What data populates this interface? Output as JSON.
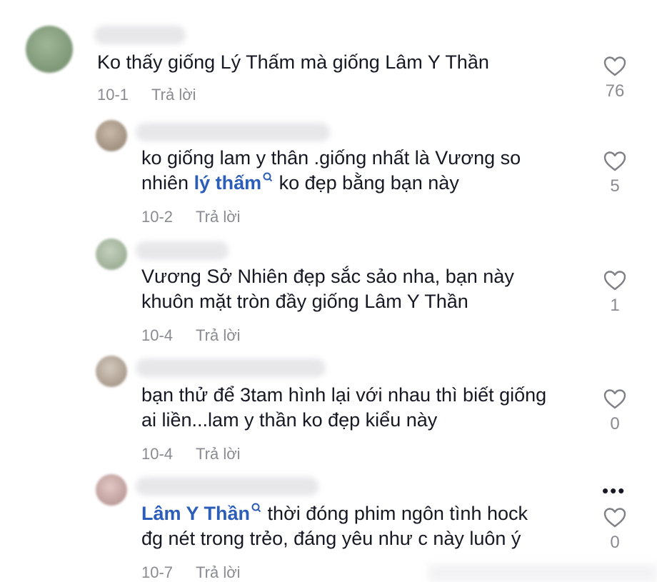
{
  "comments": [
    {
      "avatar_color": "#7f9c78",
      "text_lines": [
        "Ko thấy giống Lý Thấm mà giống Lâm Y Thần"
      ],
      "date": "10-1",
      "reply_label": "Trả lời",
      "likes": "76",
      "like_icon": "heart-outline-icon"
    },
    {
      "avatar_color": "#a89684",
      "line1": "ko giống lam y thân .giống nhất là Vương so",
      "line2_prefix": "nhiên ",
      "mention": "lý thấm",
      "line2_suffix": " ko đẹp bằng bạn này",
      "date": "10-2",
      "reply_label": "Trả lời",
      "likes": "5"
    },
    {
      "avatar_color": "#9aab92",
      "text_lines": [
        "Vương Sở Nhiên đẹp sắc sảo nha, bạn này",
        "khuôn mặt tròn đầy giống Lâm Y Thần"
      ],
      "date": "10-4",
      "reply_label": "Trả lời",
      "likes": "1"
    },
    {
      "avatar_color": "#b3a697",
      "text_lines": [
        "bạn thử để 3tam hình lại với nhau thì biết giống",
        "ai liền...lam y thần ko đẹp kiểu này"
      ],
      "date": "10-4",
      "reply_label": "Trả lời",
      "likes": "0"
    },
    {
      "avatar_color": "#c9a8a6",
      "mention": "Lâm Y Thần",
      "line1_suffix": " thời đóng phim ngôn tình hock",
      "line2": "đg nét trong trẻo, đáng yêu như c này luôn ý",
      "date": "10-7",
      "reply_label": "Trả lời",
      "likes": "0"
    }
  ],
  "more_label": "•••"
}
